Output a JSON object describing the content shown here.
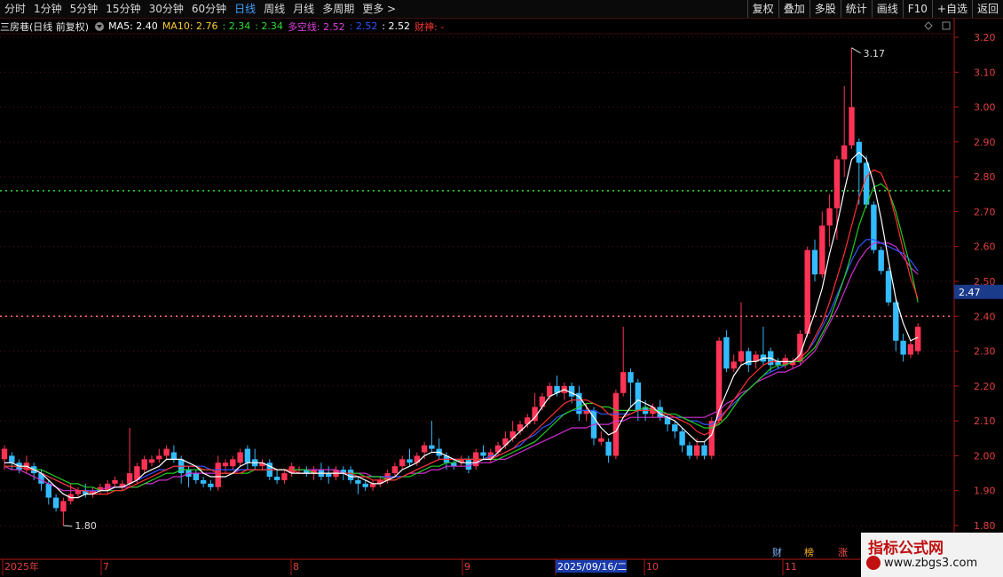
{
  "toolbar": {
    "left_items": [
      "分时",
      "1分钟",
      "5分钟",
      "15分钟",
      "30分钟",
      "60分钟",
      "日线",
      "周线",
      "月线",
      "多周期",
      "更多 >"
    ],
    "active_item": "日线",
    "right_buttons": [
      "复权",
      "叠加",
      "多股",
      "统计",
      "画线",
      "F10",
      "+自选",
      "返回"
    ]
  },
  "infobar": {
    "title": "三房巷(日线 前复权)",
    "ma5": "MA5: 2.40",
    "ma10": "MA10: 2.76",
    "v1": ": 2.34",
    "v2": ": 2.34",
    "dk": "多空线: 2.52",
    "v3": ": 2.52",
    "v4": ": 2.52",
    "caishen": "财神: -",
    "colors": {
      "ma5": "#ffffff",
      "ma10": "#ffcc33",
      "green": "#33dd33",
      "dk": "#e040e0",
      "blue": "#3355ff",
      "red": "#ff3333"
    }
  },
  "signals": {
    "cai": "财",
    "bang": "榜",
    "zhang": "涨"
  },
  "watermark": {
    "title": "指标公式网",
    "url": "www.zbgs3.com"
  },
  "chart_data": {
    "type": "candlestick",
    "y_ticks": [
      "3.20",
      "3.10",
      "3.00",
      "2.90",
      "2.80",
      "2.70",
      "2.60",
      "2.50",
      "2.40",
      "2.30",
      "2.20",
      "2.10",
      "2.00",
      "1.90",
      "1.80"
    ],
    "ylim": [
      1.78,
      3.22
    ],
    "x_labels": [
      "2025年",
      "7",
      "8",
      "9",
      "2025/09/16/二",
      "10",
      "11"
    ],
    "current_price_label": "2.47",
    "max_label": "3.17",
    "min_label": "1.80",
    "ref_lines": [
      {
        "value": 2.76,
        "color": "#33dd33"
      },
      {
        "value": 2.4,
        "color": "#ff6677"
      }
    ],
    "up_color": "#ff3355",
    "down_color": "#33bbff",
    "candles": [
      [
        1.99,
        2.02,
        1.96,
        2.03
      ],
      [
        2.0,
        1.98,
        1.96,
        2.01
      ],
      [
        1.98,
        1.96,
        1.95,
        1.99
      ],
      [
        1.96,
        1.98,
        1.95,
        2.0
      ],
      [
        1.97,
        1.95,
        1.93,
        1.98
      ],
      [
        1.95,
        1.92,
        1.9,
        1.96
      ],
      [
        1.92,
        1.88,
        1.86,
        1.93
      ],
      [
        1.88,
        1.85,
        1.84,
        1.89
      ],
      [
        1.84,
        1.87,
        1.8,
        1.88
      ],
      [
        1.87,
        1.89,
        1.86,
        1.92
      ],
      [
        1.89,
        1.9,
        1.88,
        1.91
      ],
      [
        1.9,
        1.89,
        1.88,
        1.92
      ],
      [
        1.89,
        1.9,
        1.88,
        1.91
      ],
      [
        1.9,
        1.91,
        1.89,
        1.92
      ],
      [
        1.9,
        1.92,
        1.89,
        1.93
      ],
      [
        1.92,
        1.93,
        1.91,
        1.94
      ],
      [
        1.91,
        1.92,
        1.9,
        1.93
      ],
      [
        1.92,
        1.95,
        1.91,
        2.08
      ],
      [
        1.93,
        1.97,
        1.92,
        1.98
      ],
      [
        1.96,
        1.99,
        1.95,
        2.0
      ],
      [
        1.98,
        1.99,
        1.97,
        2.0
      ],
      [
        1.99,
        2.0,
        1.98,
        2.02
      ],
      [
        2.0,
        2.02,
        1.99,
        2.03
      ],
      [
        2.01,
        1.99,
        1.98,
        2.03
      ],
      [
        1.99,
        1.95,
        1.92,
        2.0
      ],
      [
        1.96,
        1.94,
        1.91,
        1.97
      ],
      [
        1.95,
        1.93,
        1.92,
        1.96
      ],
      [
        1.93,
        1.92,
        1.91,
        1.94
      ],
      [
        1.92,
        1.91,
        1.9,
        1.93
      ],
      [
        1.91,
        1.98,
        1.9,
        2.0
      ],
      [
        1.97,
        1.98,
        1.95,
        1.99
      ],
      [
        1.97,
        1.99,
        1.96,
        2.0
      ],
      [
        1.98,
        2.01,
        1.97,
        2.02
      ],
      [
        2.02,
        1.98,
        1.96,
        2.03
      ],
      [
        1.99,
        1.97,
        1.96,
        2.02
      ],
      [
        1.97,
        1.98,
        1.96,
        1.99
      ],
      [
        1.98,
        1.94,
        1.93,
        1.99
      ],
      [
        1.94,
        1.93,
        1.92,
        1.96
      ],
      [
        1.93,
        1.95,
        1.92,
        1.96
      ],
      [
        1.95,
        1.97,
        1.94,
        1.98
      ],
      [
        1.96,
        1.96,
        1.95,
        1.97
      ],
      [
        1.96,
        1.95,
        1.94,
        1.97
      ],
      [
        1.95,
        1.96,
        1.93,
        1.97
      ],
      [
        1.96,
        1.94,
        1.93,
        1.98
      ],
      [
        1.95,
        1.94,
        1.92,
        1.97
      ],
      [
        1.94,
        1.96,
        1.93,
        1.97
      ],
      [
        1.96,
        1.95,
        1.93,
        1.97
      ],
      [
        1.96,
        1.93,
        1.92,
        1.97
      ],
      [
        1.93,
        1.92,
        1.89,
        1.94
      ],
      [
        1.92,
        1.91,
        1.9,
        1.93
      ],
      [
        1.91,
        1.92,
        1.9,
        1.93
      ],
      [
        1.92,
        1.93,
        1.91,
        1.94
      ],
      [
        1.93,
        1.95,
        1.92,
        1.96
      ],
      [
        1.95,
        1.97,
        1.94,
        1.98
      ],
      [
        1.97,
        1.99,
        1.96,
        2.0
      ],
      [
        1.99,
        1.98,
        1.97,
        2.02
      ],
      [
        1.98,
        2.0,
        1.97,
        2.01
      ],
      [
        2.01,
        2.03,
        1.99,
        2.04
      ],
      [
        2.03,
        2.02,
        2.01,
        2.1
      ],
      [
        2.02,
        2.0,
        1.99,
        2.05
      ],
      [
        2.0,
        1.98,
        1.96,
        2.01
      ],
      [
        1.98,
        1.97,
        1.96,
        1.99
      ],
      [
        1.98,
        1.99,
        1.97,
        2.0
      ],
      [
        1.99,
        1.96,
        1.95,
        2.0
      ],
      [
        1.97,
        2.01,
        1.96,
        2.02
      ],
      [
        2.01,
        2.0,
        1.99,
        2.03
      ],
      [
        1.99,
        2.01,
        1.98,
        2.02
      ],
      [
        2.01,
        2.03,
        2.0,
        2.04
      ],
      [
        2.03,
        2.05,
        2.02,
        2.07
      ],
      [
        2.05,
        2.07,
        2.04,
        2.1
      ],
      [
        2.07,
        2.09,
        2.06,
        2.1
      ],
      [
        2.09,
        2.11,
        2.08,
        2.12
      ],
      [
        2.1,
        2.14,
        2.09,
        2.18
      ],
      [
        2.14,
        2.17,
        2.13,
        2.18
      ],
      [
        2.17,
        2.2,
        2.16,
        2.21
      ],
      [
        2.2,
        2.18,
        2.17,
        2.23
      ],
      [
        2.18,
        2.2,
        2.16,
        2.21
      ],
      [
        2.2,
        2.17,
        2.15,
        2.21
      ],
      [
        2.18,
        2.12,
        2.1,
        2.2
      ],
      [
        2.12,
        2.13,
        2.1,
        2.15
      ],
      [
        2.13,
        2.05,
        2.03,
        2.14
      ],
      [
        2.04,
        2.05,
        2.03,
        2.07
      ],
      [
        2.04,
        2.0,
        1.98,
        2.05
      ],
      [
        2.0,
        2.18,
        1.99,
        2.19
      ],
      [
        2.18,
        2.24,
        2.17,
        2.37
      ],
      [
        2.24,
        2.21,
        2.14,
        2.25
      ],
      [
        2.21,
        2.13,
        2.1,
        2.22
      ],
      [
        2.14,
        2.12,
        2.1,
        2.16
      ],
      [
        2.12,
        2.14,
        2.11,
        2.15
      ],
      [
        2.14,
        2.11,
        2.1,
        2.16
      ],
      [
        2.11,
        2.09,
        2.07,
        2.12
      ],
      [
        2.09,
        2.07,
        2.05,
        2.1
      ],
      [
        2.07,
        2.03,
        2.01,
        2.08
      ],
      [
        2.03,
        2.0,
        1.99,
        2.04
      ],
      [
        2.0,
        2.03,
        1.99,
        2.05
      ],
      [
        2.03,
        2.0,
        1.99,
        2.04
      ],
      [
        2.0,
        2.1,
        1.99,
        2.11
      ],
      [
        2.1,
        2.33,
        2.09,
        2.34
      ],
      [
        2.34,
        2.25,
        2.24,
        2.36
      ],
      [
        2.25,
        2.27,
        2.24,
        2.29
      ],
      [
        2.27,
        2.3,
        2.26,
        2.44
      ],
      [
        2.3,
        2.26,
        2.24,
        2.31
      ],
      [
        2.27,
        2.29,
        2.25,
        2.3
      ],
      [
        2.29,
        2.27,
        2.26,
        2.37
      ],
      [
        2.3,
        2.26,
        2.24,
        2.31
      ],
      [
        2.27,
        2.26,
        2.25,
        2.28
      ],
      [
        2.26,
        2.28,
        2.25,
        2.29
      ],
      [
        2.26,
        2.27,
        2.25,
        2.28
      ],
      [
        2.27,
        2.35,
        2.26,
        2.36
      ],
      [
        2.35,
        2.59,
        2.34,
        2.6
      ],
      [
        2.59,
        2.52,
        2.5,
        2.62
      ],
      [
        2.52,
        2.66,
        2.51,
        2.7
      ],
      [
        2.66,
        2.71,
        2.6,
        2.75
      ],
      [
        2.71,
        2.85,
        2.62,
        2.86
      ],
      [
        2.85,
        2.89,
        2.8,
        3.06
      ],
      [
        2.89,
        3.0,
        2.88,
        3.17
      ],
      [
        2.9,
        2.84,
        2.72,
        2.91
      ],
      [
        2.84,
        2.72,
        2.71,
        2.86
      ],
      [
        2.72,
        2.59,
        2.58,
        2.73
      ],
      [
        2.59,
        2.53,
        2.52,
        2.6
      ],
      [
        2.53,
        2.44,
        2.43,
        2.54
      ],
      [
        2.44,
        2.33,
        2.3,
        2.45
      ],
      [
        2.33,
        2.29,
        2.27,
        2.35
      ],
      [
        2.29,
        2.32,
        2.28,
        2.33
      ],
      [
        2.3,
        2.37,
        2.29,
        2.38
      ]
    ],
    "ma_white": [
      1.98,
      1.98,
      1.97,
      1.97,
      1.96,
      1.95,
      1.93,
      1.91,
      1.89,
      1.88,
      1.88,
      1.89,
      1.89,
      1.9,
      1.9,
      1.91,
      1.91,
      1.92,
      1.93,
      1.95,
      1.96,
      1.97,
      1.99,
      1.99,
      1.99,
      1.98,
      1.97,
      1.95,
      1.94,
      1.94,
      1.94,
      1.95,
      1.97,
      1.98,
      1.98,
      1.98,
      1.97,
      1.96,
      1.96,
      1.95,
      1.95,
      1.95,
      1.95,
      1.95,
      1.95,
      1.95,
      1.95,
      1.94,
      1.94,
      1.93,
      1.92,
      1.92,
      1.93,
      1.94,
      1.96,
      1.97,
      1.98,
      2.0,
      2.01,
      2.01,
      2.0,
      1.99,
      1.98,
      1.98,
      1.98,
      1.99,
      1.99,
      2.01,
      2.03,
      2.05,
      2.07,
      2.09,
      2.11,
      2.14,
      2.17,
      2.18,
      2.19,
      2.18,
      2.17,
      2.14,
      2.11,
      2.08,
      2.06,
      2.07,
      2.11,
      2.14,
      2.16,
      2.15,
      2.14,
      2.12,
      2.11,
      2.1,
      2.08,
      2.06,
      2.04,
      2.04,
      2.06,
      2.13,
      2.18,
      2.23,
      2.26,
      2.27,
      2.27,
      2.28,
      2.28,
      2.27,
      2.27,
      2.27,
      2.29,
      2.35,
      2.41,
      2.48,
      2.58,
      2.66,
      2.76,
      2.85,
      2.87,
      2.85,
      2.78,
      2.68,
      2.56,
      2.45,
      2.38,
      2.33,
      2.34
    ],
    "ma_red": [
      1.97,
      1.97,
      1.97,
      1.96,
      1.96,
      1.95,
      1.94,
      1.93,
      1.92,
      1.91,
      1.9,
      1.9,
      1.89,
      1.89,
      1.89,
      1.9,
      1.9,
      1.91,
      1.92,
      1.93,
      1.94,
      1.95,
      1.96,
      1.97,
      1.97,
      1.97,
      1.97,
      1.96,
      1.96,
      1.95,
      1.95,
      1.95,
      1.95,
      1.96,
      1.96,
      1.96,
      1.96,
      1.96,
      1.96,
      1.96,
      1.95,
      1.95,
      1.95,
      1.95,
      1.95,
      1.95,
      1.95,
      1.95,
      1.94,
      1.94,
      1.93,
      1.93,
      1.93,
      1.93,
      1.94,
      1.95,
      1.96,
      1.97,
      1.98,
      1.99,
      1.99,
      1.99,
      1.99,
      1.99,
      1.99,
      1.99,
      1.99,
      2.0,
      2.01,
      2.02,
      2.04,
      2.05,
      2.07,
      2.09,
      2.11,
      2.13,
      2.15,
      2.16,
      2.16,
      2.16,
      2.15,
      2.14,
      2.12,
      2.11,
      2.11,
      2.12,
      2.13,
      2.13,
      2.13,
      2.12,
      2.12,
      2.11,
      2.1,
      2.09,
      2.07,
      2.06,
      2.07,
      2.1,
      2.13,
      2.16,
      2.19,
      2.22,
      2.24,
      2.26,
      2.27,
      2.27,
      2.27,
      2.27,
      2.28,
      2.3,
      2.34,
      2.38,
      2.44,
      2.51,
      2.58,
      2.66,
      2.74,
      2.8,
      2.82,
      2.81,
      2.76,
      2.68,
      2.59,
      2.51,
      2.45
    ],
    "ma_green": [
      1.97,
      1.97,
      1.97,
      1.97,
      1.96,
      1.96,
      1.95,
      1.94,
      1.93,
      1.92,
      1.92,
      1.91,
      1.91,
      1.9,
      1.9,
      1.9,
      1.9,
      1.91,
      1.91,
      1.92,
      1.93,
      1.94,
      1.95,
      1.95,
      1.96,
      1.96,
      1.96,
      1.96,
      1.96,
      1.95,
      1.95,
      1.95,
      1.95,
      1.95,
      1.96,
      1.96,
      1.96,
      1.96,
      1.96,
      1.96,
      1.96,
      1.96,
      1.95,
      1.95,
      1.95,
      1.95,
      1.95,
      1.95,
      1.95,
      1.94,
      1.94,
      1.94,
      1.93,
      1.93,
      1.94,
      1.94,
      1.95,
      1.96,
      1.97,
      1.97,
      1.98,
      1.98,
      1.99,
      1.99,
      1.99,
      1.99,
      1.99,
      1.99,
      2.0,
      2.01,
      2.02,
      2.03,
      2.04,
      2.06,
      2.08,
      2.1,
      2.12,
      2.13,
      2.14,
      2.15,
      2.15,
      2.14,
      2.14,
      2.13,
      2.13,
      2.13,
      2.13,
      2.14,
      2.13,
      2.13,
      2.12,
      2.12,
      2.11,
      2.1,
      2.09,
      2.08,
      2.08,
      2.09,
      2.11,
      2.14,
      2.17,
      2.19,
      2.21,
      2.23,
      2.25,
      2.26,
      2.26,
      2.27,
      2.27,
      2.29,
      2.31,
      2.35,
      2.39,
      2.45,
      2.51,
      2.58,
      2.66,
      2.72,
      2.77,
      2.78,
      2.76,
      2.7,
      2.62,
      2.54,
      2.44
    ],
    "ma_magenta": [
      1.97,
      1.96,
      1.96,
      1.95,
      1.94,
      1.93,
      1.92,
      1.91,
      1.9,
      1.9,
      1.9,
      1.9,
      1.9,
      1.9,
      1.91,
      1.91,
      1.91,
      1.91,
      1.91,
      1.92,
      1.92,
      1.93,
      1.93,
      1.94,
      1.94,
      1.95,
      1.95,
      1.95,
      1.95,
      1.95,
      1.95,
      1.95,
      1.96,
      1.96,
      1.96,
      1.96,
      1.96,
      1.96,
      1.96,
      1.96,
      1.96,
      1.96,
      1.96,
      1.96,
      1.96,
      1.96,
      1.95,
      1.95,
      1.95,
      1.95,
      1.94,
      1.94,
      1.94,
      1.94,
      1.94,
      1.95,
      1.95,
      1.95,
      1.96,
      1.96,
      1.97,
      1.97,
      1.97,
      1.97,
      1.98,
      1.98,
      1.98,
      1.99,
      1.99,
      2.0,
      2.01,
      2.02,
      2.03,
      2.04,
      2.05,
      2.06,
      2.07,
      2.08,
      2.08,
      2.08,
      2.09,
      2.09,
      2.09,
      2.1,
      2.1,
      2.11,
      2.11,
      2.11,
      2.11,
      2.11,
      2.11,
      2.11,
      2.11,
      2.11,
      2.11,
      2.11,
      2.12,
      2.13,
      2.15,
      2.16,
      2.18,
      2.19,
      2.21,
      2.22,
      2.23,
      2.24,
      2.24,
      2.25,
      2.26,
      2.28,
      2.3,
      2.34,
      2.38,
      2.42,
      2.47,
      2.52,
      2.56,
      2.59,
      2.61,
      2.61,
      2.61,
      2.6,
      2.57,
      2.54,
      2.52
    ],
    "ma_blue": [
      1.98,
      1.98,
      1.97,
      1.97,
      1.96,
      1.95,
      1.94,
      1.93,
      1.92,
      1.91,
      1.9,
      1.9,
      1.9,
      1.9,
      1.9,
      1.91,
      1.91,
      1.92,
      1.93,
      1.94,
      1.95,
      1.96,
      1.96,
      1.97,
      1.97,
      1.97,
      1.97,
      1.97,
      1.96,
      1.96,
      1.96,
      1.96,
      1.96,
      1.96,
      1.96,
      1.96,
      1.96,
      1.96,
      1.96,
      1.96,
      1.95,
      1.95,
      1.95,
      1.95,
      1.95,
      1.95,
      1.95,
      1.95,
      1.94,
      1.94,
      1.94,
      1.94,
      1.94,
      1.94,
      1.94,
      1.95,
      1.96,
      1.97,
      1.98,
      1.99,
      1.99,
      1.99,
      1.99,
      1.99,
      1.99,
      1.99,
      2.0,
      2.0,
      2.01,
      2.02,
      2.03,
      2.05,
      2.06,
      2.08,
      2.09,
      2.11,
      2.12,
      2.13,
      2.13,
      2.13,
      2.13,
      2.12,
      2.12,
      2.12,
      2.12,
      2.12,
      2.13,
      2.13,
      2.13,
      2.12,
      2.12,
      2.11,
      2.11,
      2.1,
      2.1,
      2.09,
      2.09,
      2.11,
      2.13,
      2.15,
      2.17,
      2.19,
      2.21,
      2.23,
      2.24,
      2.25,
      2.26,
      2.27,
      2.28,
      2.3,
      2.33,
      2.37,
      2.41,
      2.46,
      2.51,
      2.56,
      2.6,
      2.62,
      2.62,
      2.61,
      2.6,
      2.59,
      2.58,
      2.56,
      2.53
    ]
  }
}
